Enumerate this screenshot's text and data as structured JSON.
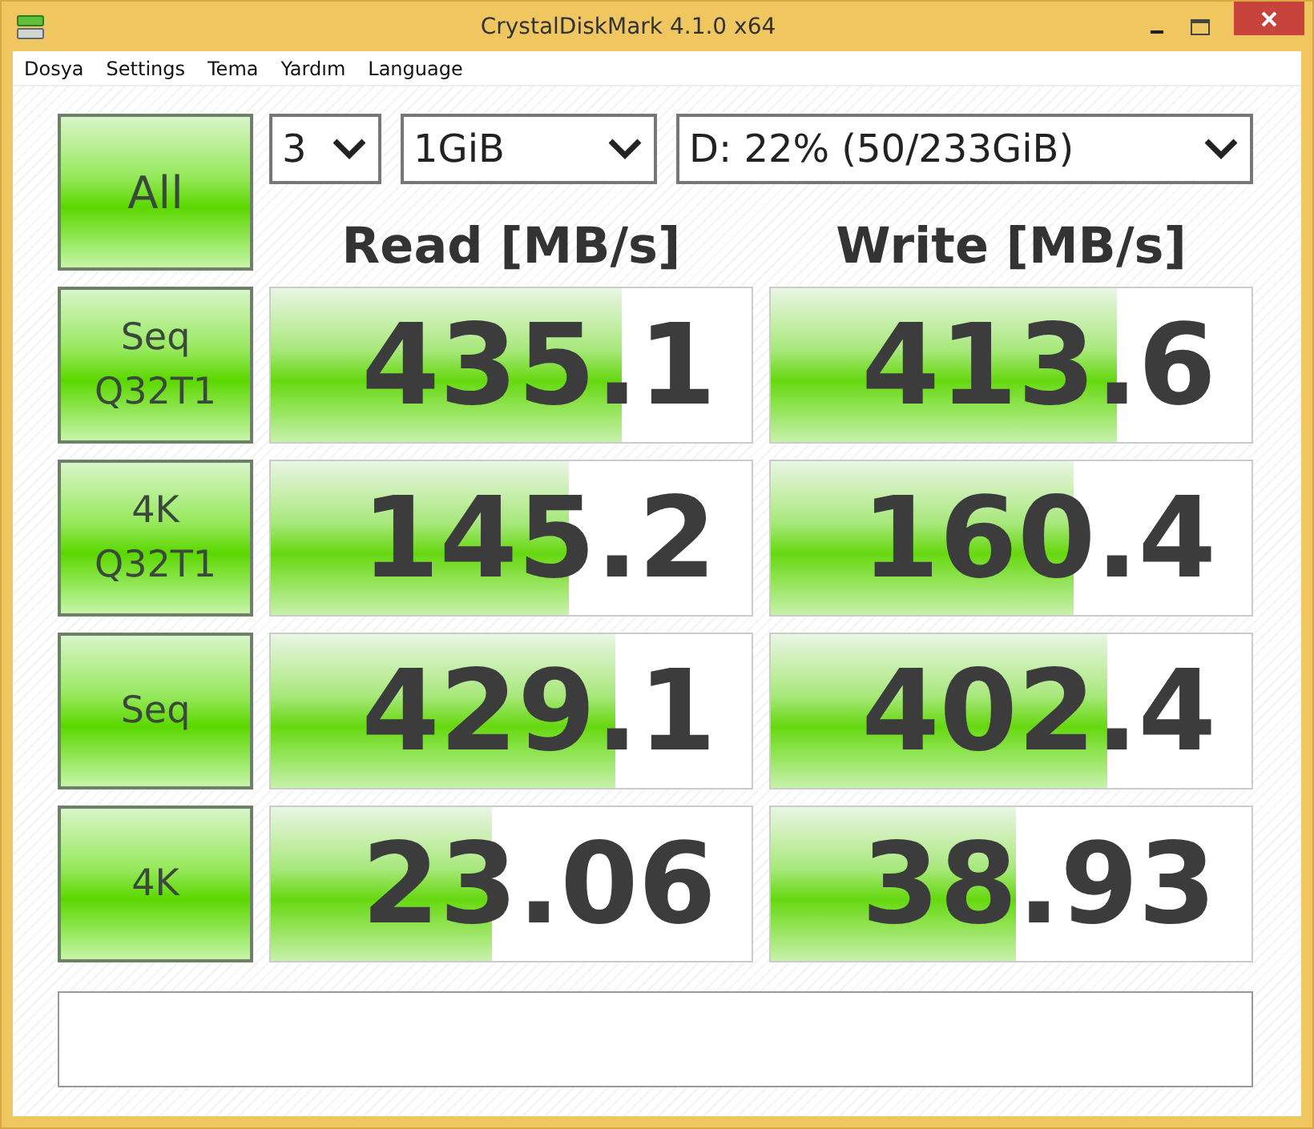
{
  "window": {
    "title": "CrystalDiskMark 4.1.0 x64"
  },
  "menu": [
    "Dosya",
    "Settings",
    "Tema",
    "Yardım",
    "Language"
  ],
  "all_button": "All",
  "selects": [
    {
      "value": "3"
    },
    {
      "value": "1GiB"
    },
    {
      "value": "D: 22% (50/233GiB)"
    }
  ],
  "headers": [
    "Read [MB/s]",
    "Write [MB/s]"
  ],
  "tests": [
    {
      "label": "Seq Q32T1",
      "read": {
        "value": "435.1",
        "level": 0.73
      },
      "write": {
        "value": "413.6",
        "level": 0.72
      }
    },
    {
      "label": "4K Q32T1",
      "read": {
        "value": "145.2",
        "level": 0.62
      },
      "write": {
        "value": "160.4",
        "level": 0.63
      }
    },
    {
      "label": "Seq",
      "read": {
        "value": "429.1",
        "level": 0.715
      },
      "write": {
        "value": "402.4",
        "level": 0.7
      }
    },
    {
      "label": "4K",
      "read": {
        "value": "23.06",
        "level": 0.46
      },
      "write": {
        "value": "38.93",
        "level": 0.51
      }
    }
  ]
}
